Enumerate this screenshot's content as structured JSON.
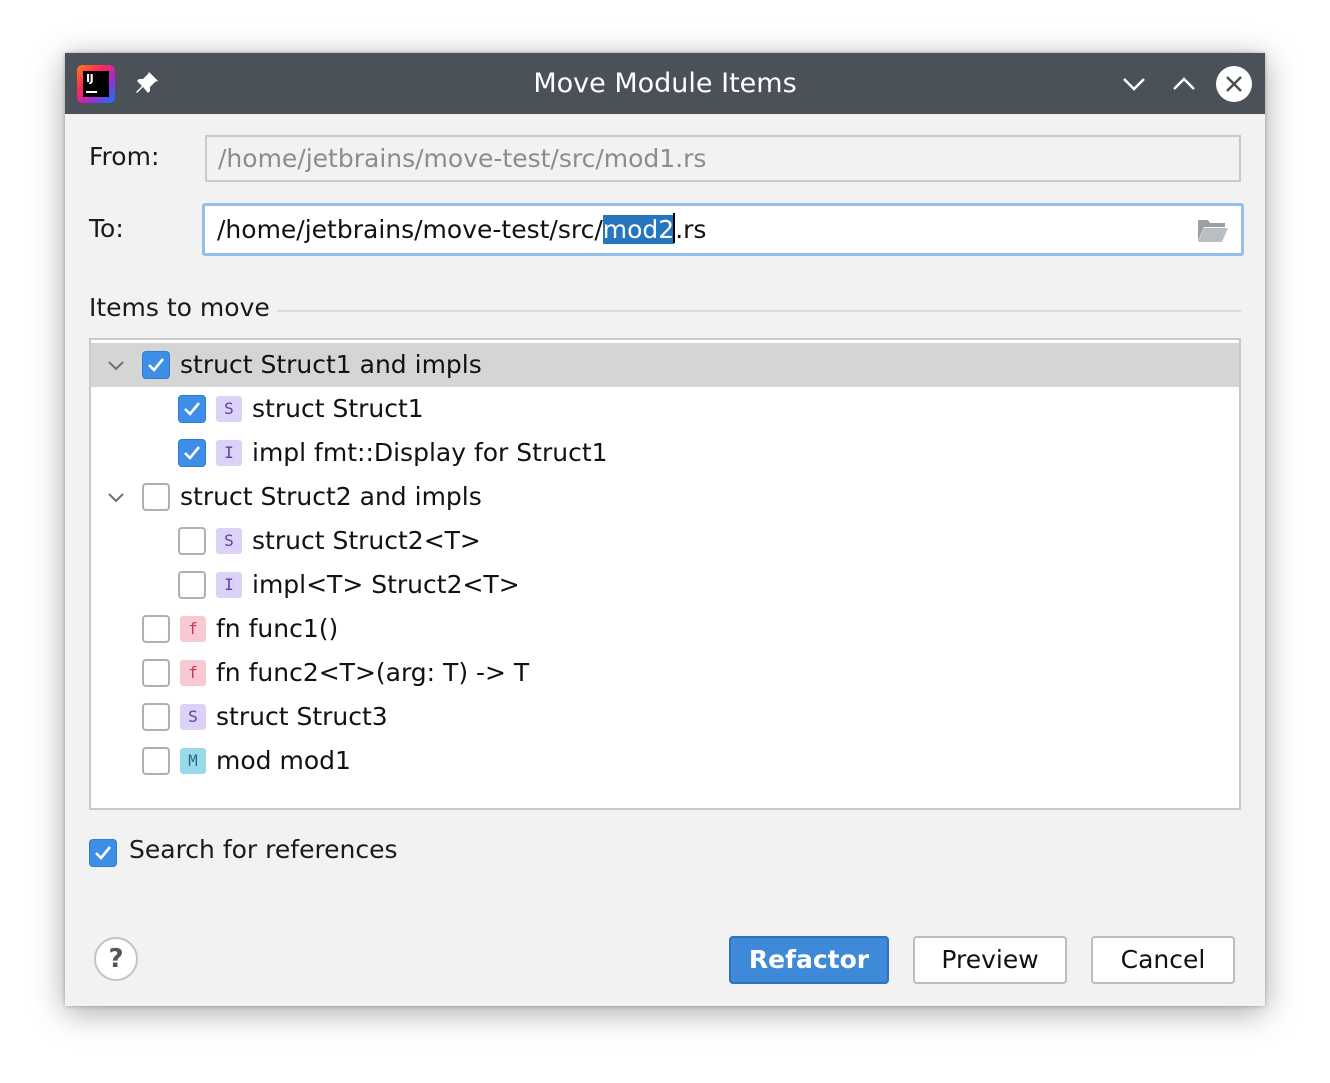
{
  "window": {
    "title": "Move Module Items",
    "app_icon_text": "IJ"
  },
  "form": {
    "from_label": "From:",
    "from_value": "/home/jetbrains/move-test/src/mod1.rs",
    "to_label": "To:",
    "to_prefix": "/home/jetbrains/move-test/src/",
    "to_selected": "mod2",
    "to_suffix": ".rs"
  },
  "items_section": {
    "title": "Items to move",
    "rows": [
      {
        "label": "struct Struct1 and impls",
        "checked": true,
        "expanded": true,
        "badge": null,
        "selected": true
      },
      {
        "label": "struct Struct1",
        "checked": true,
        "badge": "S",
        "badge_kind": "struct"
      },
      {
        "label": "impl fmt::Display for Struct1",
        "checked": true,
        "badge": "I",
        "badge_kind": "impl"
      },
      {
        "label": "struct Struct2 and impls",
        "checked": false,
        "expanded": true,
        "badge": null
      },
      {
        "label": "struct Struct2<T>",
        "checked": false,
        "badge": "S",
        "badge_kind": "struct"
      },
      {
        "label": "impl<T> Struct2<T>",
        "checked": false,
        "badge": "I",
        "badge_kind": "impl"
      },
      {
        "label": "fn func1()",
        "checked": false,
        "badge": "f",
        "badge_kind": "function"
      },
      {
        "label": "fn func2<T>(arg: T) -> T",
        "checked": false,
        "badge": "f",
        "badge_kind": "function"
      },
      {
        "label": "struct Struct3",
        "checked": false,
        "badge": "S",
        "badge_kind": "struct"
      },
      {
        "label": "mod mod1",
        "checked": false,
        "badge": "M",
        "badge_kind": "module"
      }
    ]
  },
  "options": {
    "search_references_label": "Search for references",
    "search_references_checked": true
  },
  "buttons": {
    "help": "?",
    "refactor": "Refactor",
    "preview": "Preview",
    "cancel": "Cancel"
  },
  "colors": {
    "titlebar": "#4b5158",
    "accent": "#3d8ee6",
    "selection": "#2675bf",
    "tree_selected_row": "#d5d5d5"
  }
}
